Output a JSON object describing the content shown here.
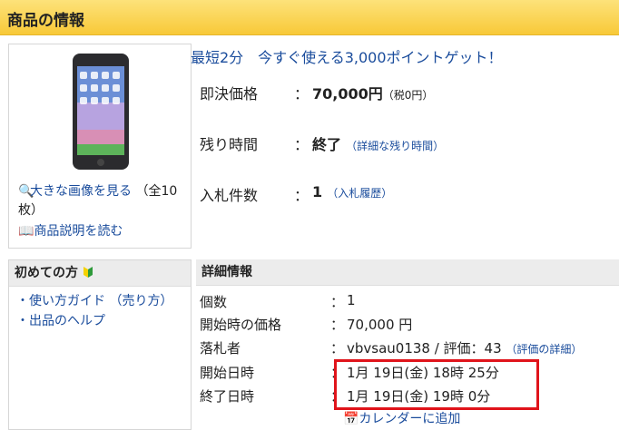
{
  "header": {
    "title": "商品の情報"
  },
  "image_panel": {
    "enlarge_link": "大きな画像を見る",
    "count_note": "（全10枚）",
    "description_link": "商品説明を読む"
  },
  "promo": "最短2分　今すぐ使える3,000ポイントゲット！",
  "price": {
    "label": "即決価格",
    "colon": "：",
    "value": "70,000円",
    "tax": "（税0円）"
  },
  "remaining": {
    "label": "残り時間",
    "colon": "：",
    "value": "終了",
    "link": "（詳細な残り時間）"
  },
  "bids": {
    "label": "入札件数",
    "colon": "：",
    "value": "1",
    "link": "（入札履歴）"
  },
  "beginners": {
    "title": "初めての方",
    "items": [
      "・使い方ガイド （売り方）",
      "・出品のヘルプ"
    ]
  },
  "details": {
    "title": "詳細情報",
    "rows": [
      {
        "label": "個数",
        "value": "1"
      },
      {
        "label": "開始時の価格",
        "value": "70,000 円"
      },
      {
        "label": "落札者",
        "value": "vbvsau0138 / 評価：43",
        "link": "（評価の詳細）"
      },
      {
        "label": "開始日時",
        "value": "1月 19日(金) 18時 25分"
      },
      {
        "label": "終了日時",
        "value": "1月 19日(金) 19時 0分"
      }
    ],
    "colon": "：",
    "calendar_link": "カレンダーに追加"
  },
  "colors": {
    "header": "#f8c938",
    "link": "#1a4c9c",
    "highlight": "#e0141b"
  }
}
